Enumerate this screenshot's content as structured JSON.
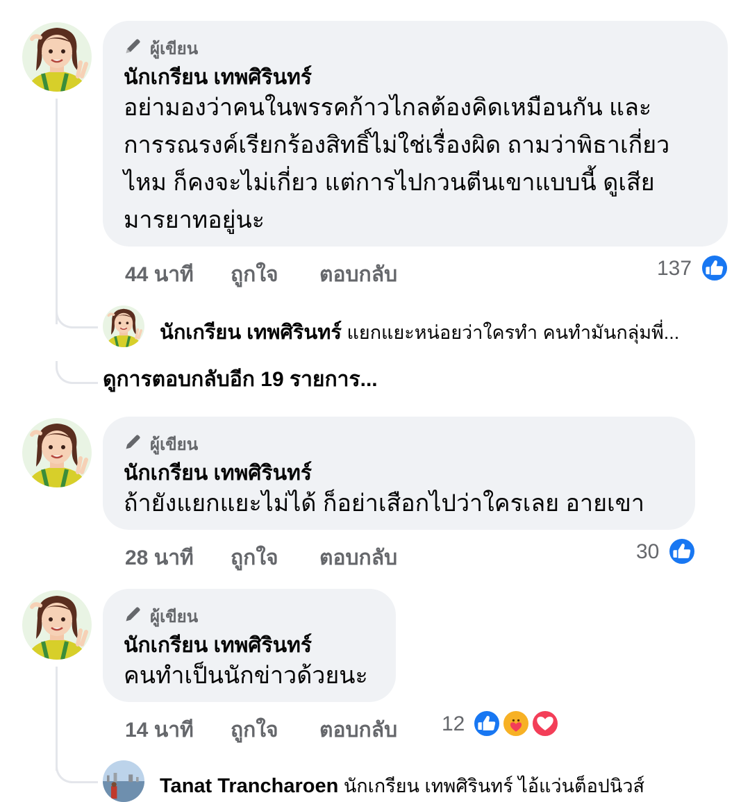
{
  "colors": {
    "like": "#1877f2",
    "love": "#f33e58",
    "care": "#f7b125",
    "bubble": "#f0f2f5",
    "meta": "#65676b"
  },
  "comments": [
    {
      "badge": "ผู้เขียน",
      "author": "นักเกรียน เทพศิรินทร์",
      "lines": [
        "อย่ามองว่าคนในพรรคก้าวไกลต้องคิดเหมือนกัน และ",
        "การรณรงค์เรียกร้องสิทธิ์ไม่ใช่เรื่องผิด ถามว่าพิธาเกี่ยว",
        "ไหม ก็คงจะไม่เกี่ยว แต่การไปกวนตีนเขาแบบนี้ ดูเสีย",
        "มารยาทอยู่นะ"
      ],
      "time": "44 นาที",
      "like": "ถูกใจ",
      "reply": "ตอบกลับ",
      "reaction_count": "137",
      "reactions": [
        "like-icon"
      ]
    },
    {
      "badge": "ผู้เขียน",
      "author": "นักเกรียน เทพศิรินทร์",
      "lines": [
        "ถ้ายังแยกแยะไม่ได้ ก็อย่าเสือกไปว่าใครเลย อายเขา"
      ],
      "time": "28 นาที",
      "like": "ถูกใจ",
      "reply": "ตอบกลับ",
      "reaction_count": "30",
      "reactions": [
        "like-icon"
      ]
    },
    {
      "badge": "ผู้เขียน",
      "author": "นักเกรียน เทพศิรินทร์",
      "lines": [
        "คนทำเป็นนักข่าวด้วยนะ"
      ],
      "time": "14 นาที",
      "like": "ถูกใจ",
      "reply": "ตอบกลับ",
      "reaction_count": "12",
      "reactions": [
        "like-icon",
        "care-icon",
        "love-icon"
      ]
    }
  ],
  "reply_preview_1": {
    "author": "นักเกรียน เทพศิรินทร์",
    "text": "แยกแยะหน่อยว่าใครทำ คนทำมันกลุ่มพี่..."
  },
  "view_more_1": "ดูการตอบกลับอีก 19 รายการ...",
  "reply_preview_3": {
    "author": "Tanat Trancharoen",
    "text": "นักเกรียน เทพศิรินทร์ ไอ้แว่นต็อปนิวส์"
  }
}
